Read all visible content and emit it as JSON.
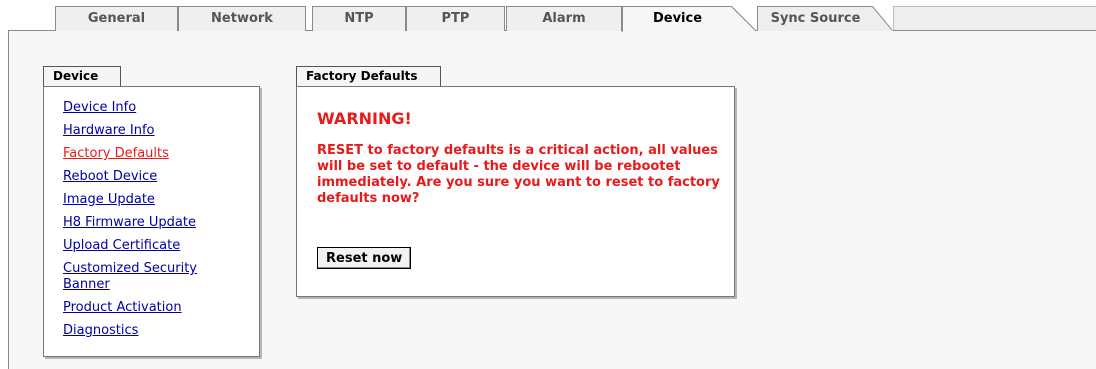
{
  "tabs": [
    {
      "label": "General"
    },
    {
      "label": "Network"
    },
    {
      "label": "NTP"
    },
    {
      "label": "PTP"
    },
    {
      "label": "Alarm"
    },
    {
      "label": "Device"
    },
    {
      "label": "Sync Source"
    }
  ],
  "active_tab": "Device",
  "device_panel": {
    "title": "Device",
    "items": [
      {
        "label": "Device Info"
      },
      {
        "label": "Hardware Info"
      },
      {
        "label": "Factory Defaults"
      },
      {
        "label": "Reboot Device"
      },
      {
        "label": "Image Update"
      },
      {
        "label": "H8 Firmware Update"
      },
      {
        "label": "Upload Certificate"
      },
      {
        "label": "Customized Security Banner"
      },
      {
        "label": "Product Activation"
      },
      {
        "label": "Diagnostics"
      }
    ],
    "selected": "Factory Defaults"
  },
  "factory_panel": {
    "title": "Factory Defaults",
    "warning_title": "WARNING!",
    "warning_text": "RESET to factory defaults is a critical action, all values will be set to default - the device will be rebootet immediately. Are you sure you want to reset to factory defaults now?",
    "reset_button": "Reset now"
  },
  "colors": {
    "warning": "#e61b1b",
    "link": "#0000a6",
    "selected_link": "#e61b1b"
  }
}
